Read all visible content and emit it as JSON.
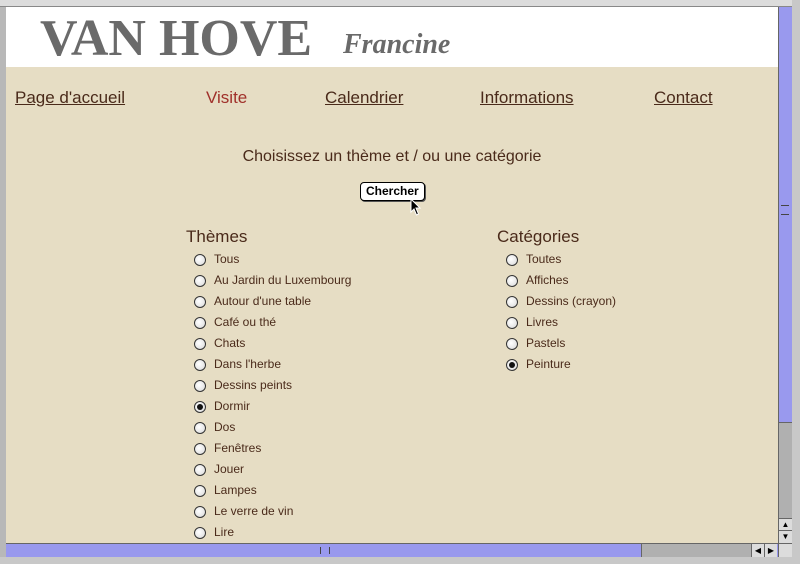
{
  "site": {
    "surname": "VAN HOVE",
    "firstname": "Francine"
  },
  "nav": [
    {
      "label": "Page d'accueil",
      "current": false
    },
    {
      "label": "Visite",
      "current": true
    },
    {
      "label": "Calendrier",
      "current": false
    },
    {
      "label": "Informations",
      "current": false
    },
    {
      "label": "Contact",
      "current": false
    }
  ],
  "search": {
    "prompt": "Choisissez un thème et / ou une catégorie",
    "button_label": "Chercher"
  },
  "themes": {
    "title": "Thèmes",
    "options": [
      {
        "label": "Tous",
        "checked": false
      },
      {
        "label": "Au Jardin du Luxembourg",
        "checked": false
      },
      {
        "label": "Autour d'une table",
        "checked": false
      },
      {
        "label": "Café ou thé",
        "checked": false
      },
      {
        "label": "Chats",
        "checked": false
      },
      {
        "label": "Dans l'herbe",
        "checked": false
      },
      {
        "label": "Dessins peints",
        "checked": false
      },
      {
        "label": "Dormir",
        "checked": true
      },
      {
        "label": "Dos",
        "checked": false
      },
      {
        "label": "Fenêtres",
        "checked": false
      },
      {
        "label": "Jouer",
        "checked": false
      },
      {
        "label": "Lampes",
        "checked": false
      },
      {
        "label": "Le verre de vin",
        "checked": false
      },
      {
        "label": "Lire",
        "checked": false
      }
    ]
  },
  "categories": {
    "title": "Catégories",
    "options": [
      {
        "label": "Toutes",
        "checked": false
      },
      {
        "label": "Affiches",
        "checked": false
      },
      {
        "label": "Dessins (crayon)",
        "checked": false
      },
      {
        "label": "Livres",
        "checked": false
      },
      {
        "label": "Pastels",
        "checked": false
      },
      {
        "label": "Peinture",
        "checked": true
      }
    ]
  },
  "colors": {
    "background": "#e6ddc4",
    "text": "#4a2a1a",
    "current_link": "#a0302a",
    "scrollbar_track": "#9999ee"
  },
  "icons": {
    "cursor": "arrow-cursor-icon",
    "up": "arrow-up-icon",
    "down": "arrow-down-icon",
    "left": "arrow-left-icon",
    "right": "arrow-right-icon"
  }
}
